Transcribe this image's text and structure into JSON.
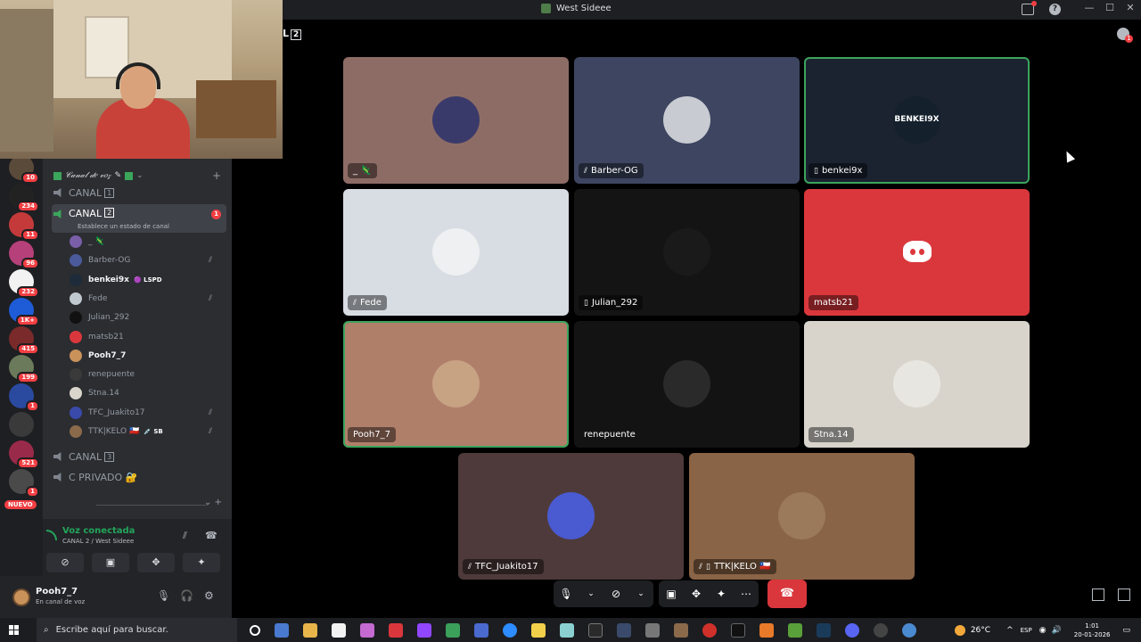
{
  "window": {
    "title": "West Sideee",
    "canal_label": "L",
    "canal_num": "2"
  },
  "servers": [
    {
      "badge": "10",
      "color": "#5a4a3a"
    },
    {
      "badge": "234",
      "color": "#222",
      "label": "COMPLEX"
    },
    {
      "badge": "11",
      "color": "#c43a3a"
    },
    {
      "badge": "96",
      "color": "#b5407a"
    },
    {
      "badge": "232",
      "color": "#f2f2f2"
    },
    {
      "badge": "1K+",
      "color": "#1e5bd6"
    },
    {
      "badge": "415",
      "color": "#7a2a2a"
    },
    {
      "badge": "199",
      "color": "#6a7a5a"
    },
    {
      "badge": "1",
      "color": "#2a4aa0"
    },
    {
      "badge": "",
      "color": "#3a3a3a"
    },
    {
      "badge": "521",
      "color": "#9a2a4a"
    },
    {
      "badge": "1",
      "color": "#4a4a4a"
    }
  ],
  "servers_new": "NUEVO",
  "sidebar": {
    "category": "𝒞𝒶𝓃𝒶𝓁 𝒹𝑒 𝓋𝑜𝓏",
    "channels": [
      {
        "label": "CANAL",
        "num": "1"
      },
      {
        "label": "CANAL",
        "num": "2",
        "subtitle": "Establece un estado de canal",
        "badge": "1"
      },
      {
        "label": "CANAL",
        "num": "3"
      },
      {
        "label": "C PRIVADO 🔐"
      }
    ],
    "members": [
      {
        "name": "_ 🦎",
        "color": "#7a5ea8",
        "bold": false,
        "muted": false
      },
      {
        "name": "Barber-OG",
        "color": "#4a5a9a",
        "bold": false,
        "muted": true
      },
      {
        "name": "benkei9x",
        "color": "#1d2b3a",
        "bold": true,
        "tag": "🟣 LSPD",
        "muted": false
      },
      {
        "name": "Fede",
        "color": "#c0c8d0",
        "bold": false,
        "muted": true
      },
      {
        "name": "Julian_292",
        "color": "#111",
        "bold": false,
        "muted": false
      },
      {
        "name": "matsb21",
        "color": "#da373c",
        "bold": false,
        "muted": false
      },
      {
        "name": "Pooh7_7",
        "color": "#c8925a",
        "bold": true,
        "muted": false
      },
      {
        "name": "renepuente",
        "color": "#3a3a3a",
        "bold": false,
        "muted": false
      },
      {
        "name": "Stna.14",
        "color": "#d9d5cc",
        "bold": false,
        "muted": false
      },
      {
        "name": "TFC_Juakito17",
        "color": "#3a4aaa",
        "bold": false,
        "muted": true
      },
      {
        "name": "TTK|KELO 🇨🇱",
        "color": "#8a6a4a",
        "bold": false,
        "tag": "💉 SB",
        "muted": true
      }
    ]
  },
  "voice": {
    "title": "Voz conectada",
    "sub": "CANAL 2 / West Sideee"
  },
  "user": {
    "name": "Pooh7_7",
    "status": "En canal de voz"
  },
  "tiles": [
    {
      "name": "_ 🦎",
      "bg": "#8e6c66",
      "av": "#3a3a6a",
      "icon": "",
      "speaking": false
    },
    {
      "name": "Barber-OG",
      "bg": "#3d4561",
      "av": "#c9cbd2",
      "icon": "mic-off",
      "speaking": false
    },
    {
      "name": "benkei9x",
      "bg": "#1b2230",
      "av": "#14202c",
      "icon": "phone",
      "speaking": true,
      "av_text": "BENKEI9X"
    },
    {
      "name": "Fede",
      "bg": "#d8dde3",
      "av": "#eef0f2",
      "icon": "mic-off",
      "speaking": false
    },
    {
      "name": "Julian_292",
      "bg": "#141414",
      "av": "#1a1a1a",
      "icon": "phone",
      "speaking": false
    },
    {
      "name": "matsb21",
      "bg": "#da373c",
      "av": "",
      "icon": "",
      "speaking": false,
      "discord": true
    },
    {
      "name": "Pooh7_7",
      "bg": "#b07f6a",
      "av": "#c7a283",
      "icon": "",
      "speaking": true
    },
    {
      "name": "renepuente",
      "bg": "#131313",
      "av": "#2a2a2a",
      "icon": "",
      "speaking": false,
      "plain": true
    },
    {
      "name": "Stna.14",
      "bg": "#d8d4cc",
      "av": "#e8e6e0",
      "icon": "",
      "speaking": false
    },
    {
      "name": "TFC_Juakito17",
      "bg": "#4e3a3a",
      "av": "#4a5ad0",
      "icon": "mic-off",
      "speaking": false
    },
    {
      "name": "TTK|KELO 🇨🇱",
      "bg": "#8a6446",
      "av": "#9a7a5a",
      "icon": "mic-off phone",
      "speaking": false
    }
  ],
  "taskbar": {
    "search_placeholder": "Escribe aquí para buscar.",
    "weather": "26°C",
    "lang": "ESP",
    "time": "1:01",
    "date": "20-01-2026"
  }
}
